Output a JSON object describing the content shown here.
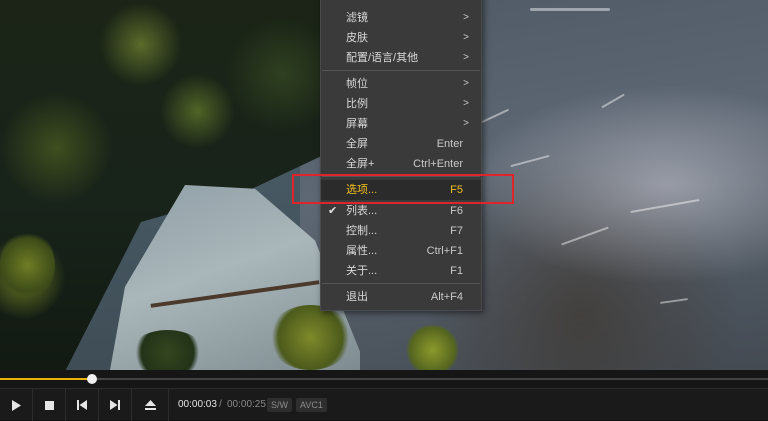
{
  "menu": {
    "items": [
      {
        "label": "",
        "top": 0
      },
      {
        "label": "滤镜",
        "submenu": true
      },
      {
        "label": "皮肤",
        "submenu": true
      },
      {
        "label": "配置/语言/其他",
        "submenu": true
      },
      {
        "label": "帧位",
        "submenu": true
      },
      {
        "label": "比例",
        "submenu": true
      },
      {
        "label": "屏幕",
        "submenu": true
      },
      {
        "label": "全屏",
        "shortcut": "Enter"
      },
      {
        "label": "全屏+",
        "shortcut": "Ctrl+Enter"
      },
      {
        "label": "选项...",
        "shortcut": "F5",
        "highlighted": true
      },
      {
        "label": "列表...",
        "shortcut": "F6",
        "checked": true
      },
      {
        "label": "控制...",
        "shortcut": "F7"
      },
      {
        "label": "属性...",
        "shortcut": "Ctrl+F1"
      },
      {
        "label": "关于...",
        "shortcut": "F1"
      },
      {
        "label": "退出",
        "shortcut": "Alt+F4"
      }
    ],
    "check_glyph": "✔",
    "arrow_glyph": ">"
  },
  "player": {
    "progress_fraction": 0.12,
    "current_time": "00:00:03",
    "time_separator": "/",
    "total_time": "00:00:25",
    "badge_sw": "S/W",
    "badge_codec": "AVC1",
    "accent_color": "#e9b200",
    "icons": [
      "play-icon",
      "stop-icon",
      "previous-icon",
      "next-icon",
      "eject-icon"
    ]
  }
}
